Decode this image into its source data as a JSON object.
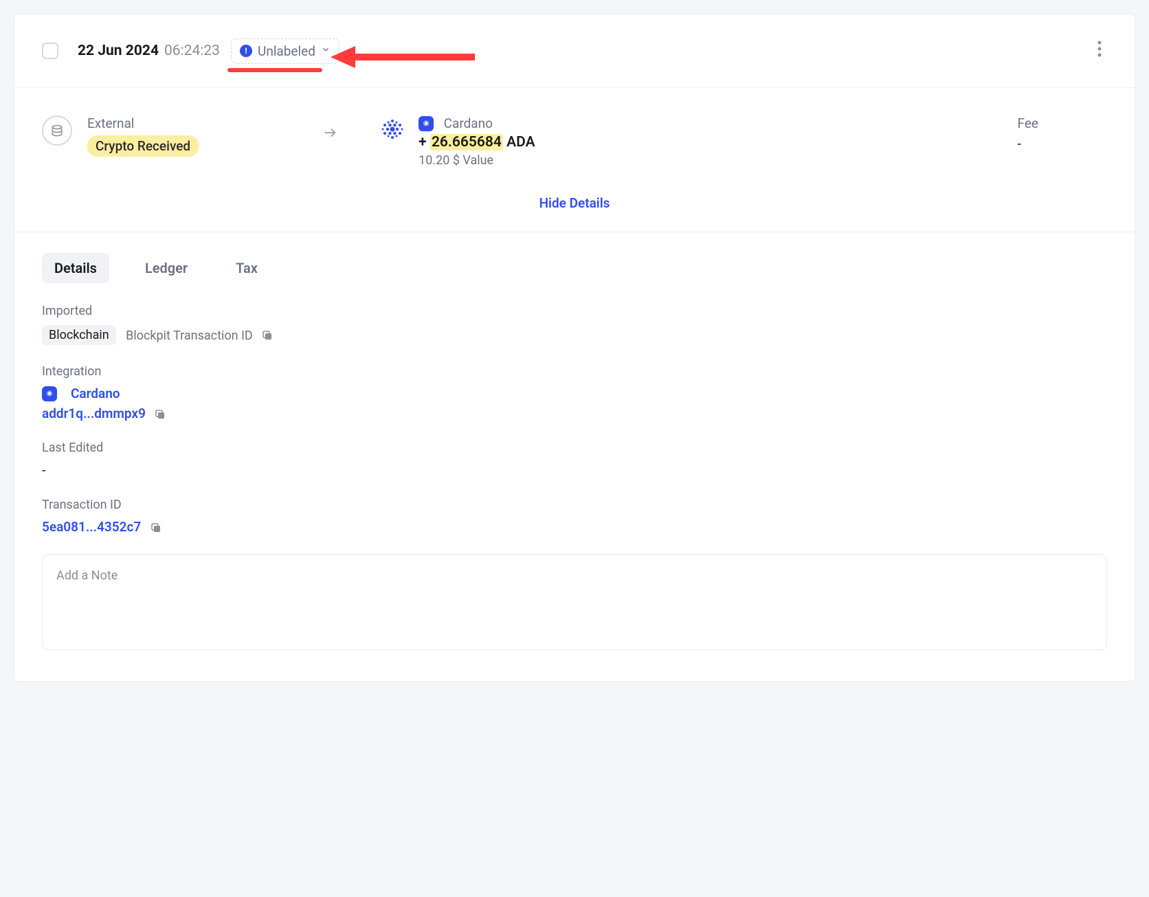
{
  "header": {
    "date": "22 Jun 2024",
    "time": "06:24:23",
    "label_text": "Unlabeled"
  },
  "flow": {
    "source_label": "External",
    "source_type": "Crypto Received",
    "chain_name": "Cardano",
    "amount_sign": "+",
    "amount_number": "26.665684",
    "amount_currency": "ADA",
    "value_text": "10.20 $ Value",
    "fee_label": "Fee",
    "fee_value": "-"
  },
  "hide_details_label": "Hide Details",
  "tabs": {
    "details": "Details",
    "ledger": "Ledger",
    "tax": "Tax"
  },
  "details": {
    "imported_label": "Imported",
    "imported_chip": "Blockchain",
    "blockpit_id_label": "Blockpit Transaction ID",
    "integration_label": "Integration",
    "integration_chain": "Cardano",
    "integration_address": "addr1q...dmmpx9",
    "last_edited_label": "Last Edited",
    "last_edited_value": "-",
    "transaction_id_label": "Transaction ID",
    "transaction_id_value": "5ea081...4352c7",
    "note_placeholder": "Add a Note"
  }
}
